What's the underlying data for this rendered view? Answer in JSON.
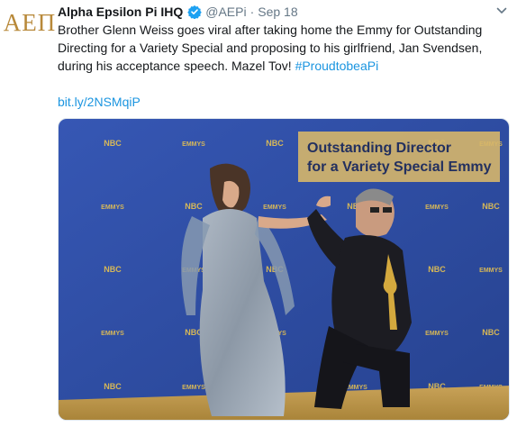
{
  "tweet": {
    "avatar_text": "ΑΕΠ",
    "author_name": "Alpha Epsilon Pi IHQ",
    "handle": "@AEPi",
    "separator": "·",
    "date": "Sep 18",
    "text_main": "Brother Glenn Weiss goes viral after taking home the Emmy for Outstanding Directing for a Variety Special and proposing to his girlfriend, Jan Svendsen, during his acceptance speech. Mazel Tov! ",
    "hashtag": "#ProudtobeaPi",
    "link": "bit.ly/2NSMqiP"
  },
  "media": {
    "caption_line1": "Outstanding Director",
    "caption_line2": "for a Variety Special Emmy",
    "backdrop_logo_nbc": "NBC",
    "backdrop_logo_emmys": "EMMYS"
  },
  "colors": {
    "accent": "#1b95e0",
    "verified": "#1da1f2",
    "backdrop": "#2f4fa8",
    "caption_box": "#d6b66a",
    "avatar_gold": "#b8893a"
  }
}
